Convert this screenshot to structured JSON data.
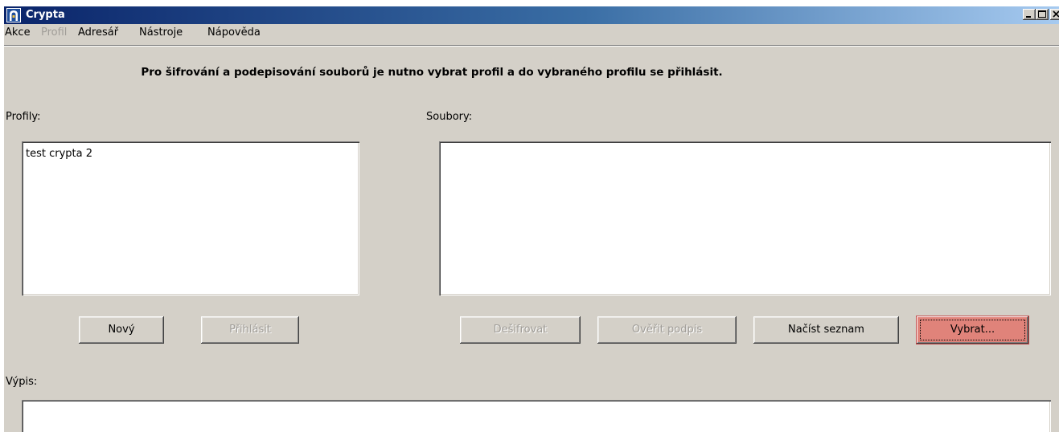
{
  "window": {
    "title": "Crypta",
    "controls": {
      "minimize": "minimize-icon",
      "maximize": "maximize-icon",
      "close": "close-icon"
    }
  },
  "menu": {
    "items": [
      {
        "label": "Akce",
        "enabled": true
      },
      {
        "label": "Profil",
        "enabled": false
      },
      {
        "label": "Adresář",
        "enabled": true
      },
      {
        "label": "Nástroje",
        "enabled": true
      },
      {
        "label": "Nápověda",
        "enabled": true
      }
    ]
  },
  "main": {
    "headline": "Pro šifrování a podepisování souborů je nutno vybrat profil a do vybraného profilu se přihlásit.",
    "profiles_label": "Profily:",
    "profiles": [
      "test crypta 2"
    ],
    "files_label": "Soubory:",
    "files": [],
    "output_label": "Výpis:"
  },
  "buttons": {
    "new": {
      "label": "Nový",
      "enabled": true
    },
    "login": {
      "label": "Přihlásit",
      "enabled": false
    },
    "decrypt": {
      "label": "Dešifrovat",
      "enabled": false
    },
    "verify": {
      "label": "Ověřit podpis",
      "enabled": false
    },
    "load_list": {
      "label": "Načíst seznam",
      "enabled": true
    },
    "select": {
      "label": "Vybrat...",
      "enabled": true,
      "focused": true
    }
  },
  "colors": {
    "titlebar_start": "#0a246a",
    "titlebar_end": "#a6caf0",
    "window_bg": "#d4d0c8",
    "focused_button": "#e0837a",
    "disabled_text": "#a09d98"
  }
}
